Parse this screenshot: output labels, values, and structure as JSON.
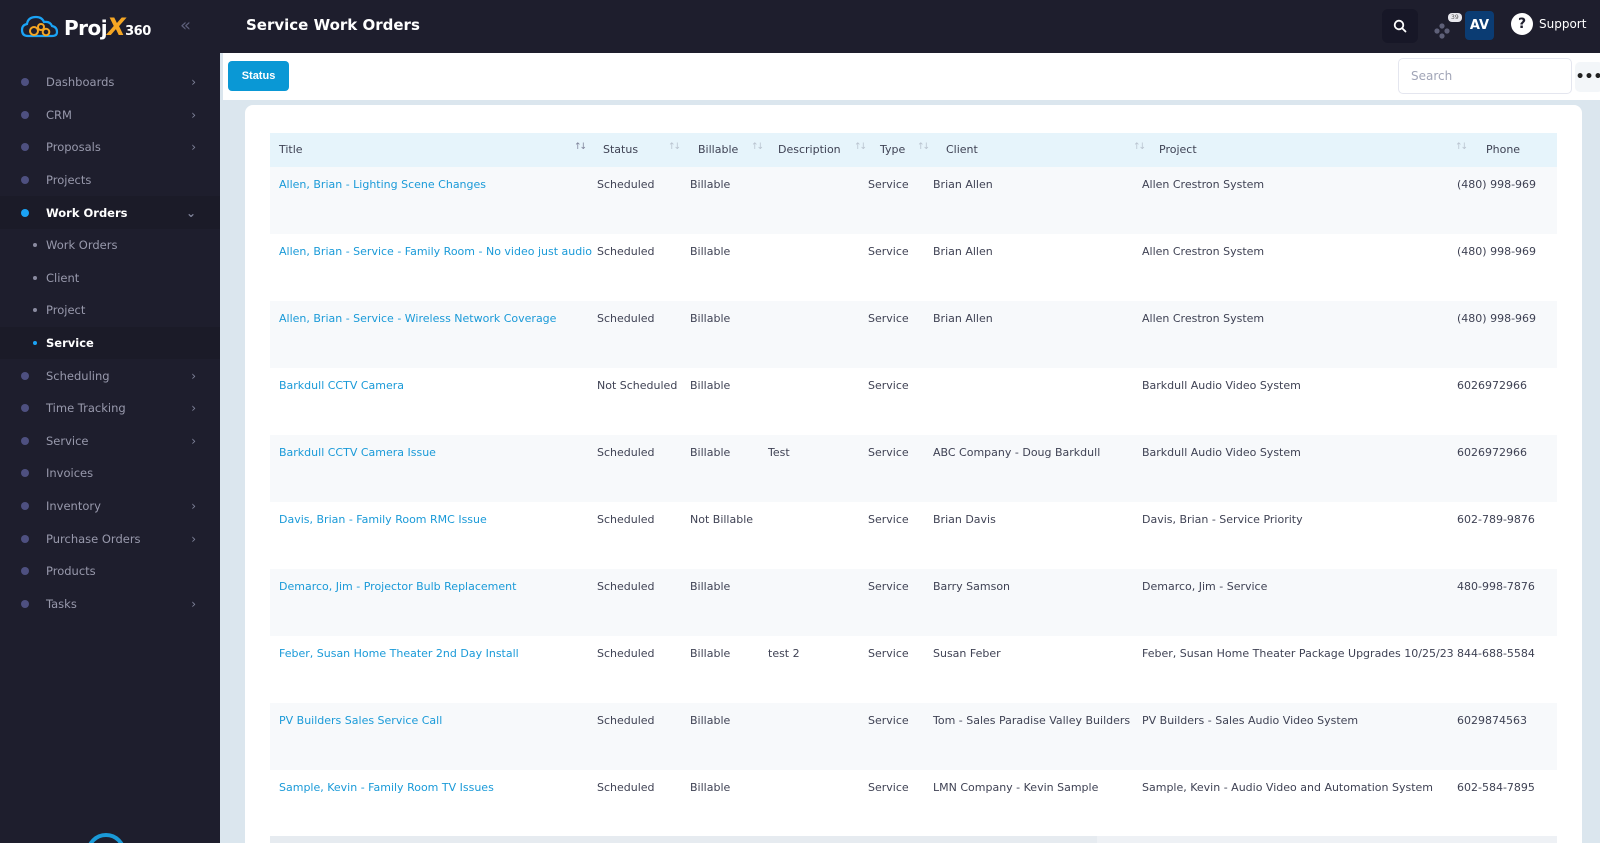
{
  "app": {
    "brand_name": "Proj",
    "brand_x": "X",
    "brand_num": "360",
    "collapse_icon": "«"
  },
  "sidebar": {
    "items": [
      {
        "label": "Dashboards",
        "has_children": true
      },
      {
        "label": "CRM",
        "has_children": true
      },
      {
        "label": "Proposals",
        "has_children": true
      },
      {
        "label": "Projects",
        "has_children": false
      },
      {
        "label": "Work Orders",
        "has_children": true,
        "open": true,
        "children": [
          {
            "label": "Work Orders"
          },
          {
            "label": "Client"
          },
          {
            "label": "Project"
          },
          {
            "label": "Service",
            "active": true
          }
        ]
      },
      {
        "label": "Scheduling",
        "has_children": true
      },
      {
        "label": "Time Tracking",
        "has_children": true
      },
      {
        "label": "Service",
        "has_children": true
      },
      {
        "label": "Invoices",
        "has_children": false
      },
      {
        "label": "Inventory",
        "has_children": true
      },
      {
        "label": "Purchase Orders",
        "has_children": true
      },
      {
        "label": "Products",
        "has_children": false
      },
      {
        "label": "Tasks",
        "has_children": true
      }
    ]
  },
  "header": {
    "title": "Service Work Orders",
    "notification_count": "39",
    "avatar_initials": "AV",
    "support_label": "Support"
  },
  "toolbar": {
    "status_label": "Status",
    "search_placeholder": "Search",
    "more_label": "•••"
  },
  "table": {
    "columns": [
      "Title",
      "Status",
      "Billable",
      "Description",
      "Type",
      "Client",
      "Project",
      "Phone"
    ],
    "rows": [
      {
        "title": "Allen, Brian - Lighting Scene Changes",
        "status": "Scheduled",
        "billable": "Billable",
        "description": "",
        "type": "Service",
        "client": "Brian Allen",
        "project": "Allen Crestron System",
        "phone": "(480) 998-969"
      },
      {
        "title": "Allen, Brian - Service - Family Room - No video just audio",
        "status": "Scheduled",
        "billable": "Billable",
        "description": "",
        "type": "Service",
        "client": "Brian Allen",
        "project": "Allen Crestron System",
        "phone": "(480) 998-969"
      },
      {
        "title": "Allen, Brian - Service - Wireless Network Coverage",
        "status": "Scheduled",
        "billable": "Billable",
        "description": "",
        "type": "Service",
        "client": "Brian Allen",
        "project": "Allen Crestron System",
        "phone": "(480) 998-969"
      },
      {
        "title": "Barkdull CCTV Camera",
        "status": "Not Scheduled",
        "billable": "Billable",
        "description": "",
        "type": "Service",
        "client": "",
        "project": "Barkdull Audio Video System",
        "phone": "6026972966"
      },
      {
        "title": "Barkdull CCTV Camera Issue",
        "status": "Scheduled",
        "billable": "Billable",
        "description": "Test",
        "type": "Service",
        "client": "ABC Company - Doug Barkdull",
        "project": "Barkdull Audio Video System",
        "phone": "6026972966"
      },
      {
        "title": "Davis, Brian - Family Room RMC Issue",
        "status": "Scheduled",
        "billable": "Not Billable",
        "description": "",
        "type": "Service",
        "client": "Brian Davis",
        "project": "Davis, Brian - Service Priority",
        "phone": "602-789-9876"
      },
      {
        "title": "Demarco, Jim - Projector Bulb Replacement",
        "status": "Scheduled",
        "billable": "Billable",
        "description": "",
        "type": "Service",
        "client": "Barry Samson",
        "project": "Demarco, Jim - Service",
        "phone": "480-998-7876"
      },
      {
        "title": "Feber, Susan Home Theater 2nd Day Install",
        "status": "Scheduled",
        "billable": "Billable",
        "description": "test 2",
        "type": "Service",
        "client": "Susan Feber",
        "project": "Feber, Susan Home Theater Package Upgrades 10/25/23",
        "phone": "844-688-5584"
      },
      {
        "title": "PV Builders Sales Service Call",
        "status": "Scheduled",
        "billable": "Billable",
        "description": "",
        "type": "Service",
        "client": "Tom - Sales Paradise Valley Builders",
        "project": "PV Builders - Sales Audio Video System",
        "phone": "6029874563"
      },
      {
        "title": "Sample, Kevin - Family Room TV Issues",
        "status": "Scheduled",
        "billable": "Billable",
        "description": "",
        "type": "Service",
        "client": "LMN Company - Kevin Sample",
        "project": "Sample, Kevin - Audio Video and Automation System",
        "phone": "602-584-7895"
      }
    ]
  },
  "colors": {
    "sidebar_bg": "#1e1e2d",
    "accent": "#0a98d5",
    "link": "#1a9ad8",
    "header_row_bg": "#e6f4fb"
  }
}
